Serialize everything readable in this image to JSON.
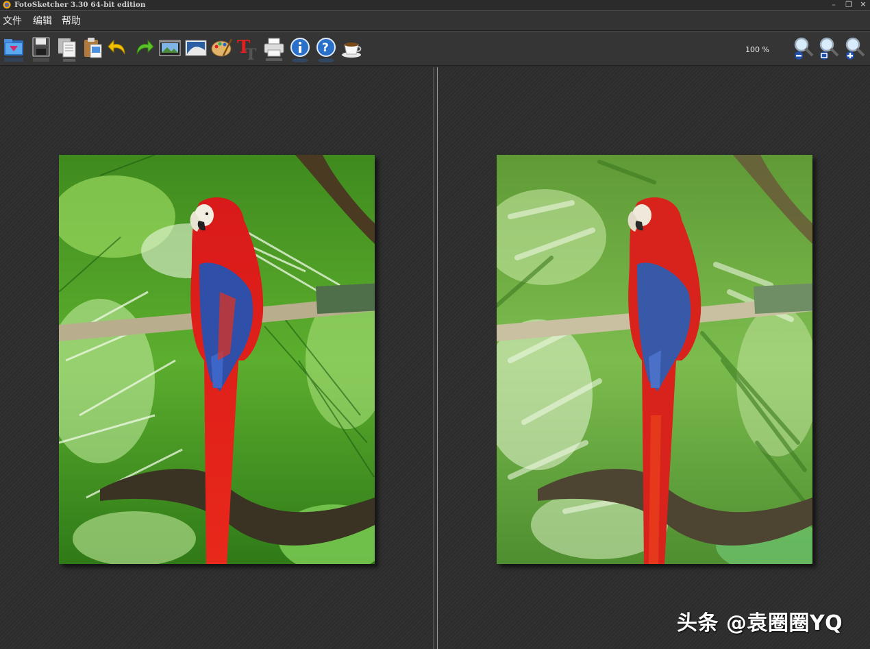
{
  "window": {
    "title": "FotoSketcher 3.30 64-bit edition",
    "controls": {
      "minimize": "–",
      "restore": "❐",
      "close": "✕"
    }
  },
  "menu": {
    "items": [
      {
        "label": "文件"
      },
      {
        "label": "编辑"
      },
      {
        "label": "帮助"
      }
    ]
  },
  "toolbar": {
    "tools": [
      {
        "icon": "open-folder-icon"
      },
      {
        "icon": "save-floppy-icon"
      },
      {
        "icon": "copy-icon"
      },
      {
        "icon": "paste-icon"
      },
      {
        "icon": "undo-icon"
      },
      {
        "icon": "redo-icon"
      },
      {
        "icon": "film-strip-icon"
      },
      {
        "icon": "picture-icon"
      },
      {
        "icon": "palette-icon"
      },
      {
        "icon": "text-tool-icon"
      },
      {
        "icon": "printer-icon"
      },
      {
        "icon": "info-icon"
      },
      {
        "icon": "help-icon"
      },
      {
        "icon": "coffee-cup-icon"
      }
    ],
    "zoom_level": "100 %",
    "zoom_buttons": [
      {
        "icon": "zoom-out-icon"
      },
      {
        "icon": "zoom-reset-icon"
      },
      {
        "icon": "zoom-in-icon"
      }
    ]
  },
  "panels": {
    "left": {
      "image": "original-parrot-photo"
    },
    "right": {
      "image": "painted-parrot-photo"
    }
  },
  "watermark": {
    "text": "头条 @袁圈圈YQ"
  },
  "colors": {
    "background": "#2c2c2c",
    "toolbar": "#353535",
    "parrot_red": "#d8141c",
    "parrot_blue": "#2f4fa8",
    "leaf_green": "#4fa62a"
  }
}
